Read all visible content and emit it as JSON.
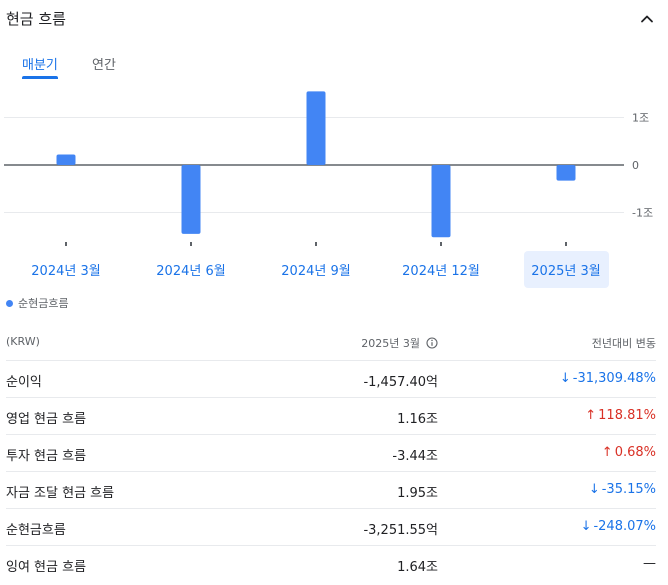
{
  "header": {
    "title": "현금 흐름"
  },
  "tabs": [
    {
      "label": "매분기",
      "active": true
    },
    {
      "label": "연간",
      "active": false
    }
  ],
  "chart_data": {
    "type": "bar",
    "categories": [
      "2024년 3월",
      "2024년 6월",
      "2024년 9월",
      "2024년 12월",
      "2025년 3월"
    ],
    "series": [
      {
        "name": "순현금흐름",
        "values": [
          0.22,
          -1.45,
          1.55,
          -1.52,
          -0.33
        ],
        "color": "#4285f4"
      }
    ],
    "yticks": [
      {
        "value": 1,
        "label": "1조"
      },
      {
        "value": 0,
        "label": "0"
      },
      {
        "value": -1,
        "label": "-1조"
      }
    ],
    "ylim": [
      -1.7,
      1.7
    ],
    "unit": "조",
    "selected_index": 4,
    "grid": true,
    "legend_position": "bottom-left"
  },
  "legend": {
    "label": "순현금흐름"
  },
  "table": {
    "headers": {
      "label": "(KRW)",
      "period": "2025년 3월",
      "change": "전년대비 변동"
    },
    "rows": [
      {
        "label": "순이익",
        "value": "-1,457.40억",
        "change": "-31,309.48%",
        "direction": "down"
      },
      {
        "label": "영업 현금 흐름",
        "value": "1.16조",
        "change": "118.81%",
        "direction": "up"
      },
      {
        "label": "투자 현금 흐름",
        "value": "-3.44조",
        "change": "0.68%",
        "direction": "up"
      },
      {
        "label": "자금 조달 현금 흐름",
        "value": "1.95조",
        "change": "-35.15%",
        "direction": "down"
      },
      {
        "label": "순현금흐름",
        "value": "-3,251.55억",
        "change": "-248.07%",
        "direction": "down"
      },
      {
        "label": "잉여 현금 흐름",
        "value": "1.64조",
        "change": "—",
        "direction": "none"
      }
    ]
  },
  "colors": {
    "accent": "#1a73e8",
    "bar": "#4285f4",
    "up": "#d93025",
    "down": "#1a73e8",
    "selected_bg": "#e8f0fe"
  },
  "icons": {
    "collapse": "chevron-up-icon",
    "info": "info-icon",
    "up": "arrow-up-icon",
    "down": "arrow-down-icon"
  }
}
